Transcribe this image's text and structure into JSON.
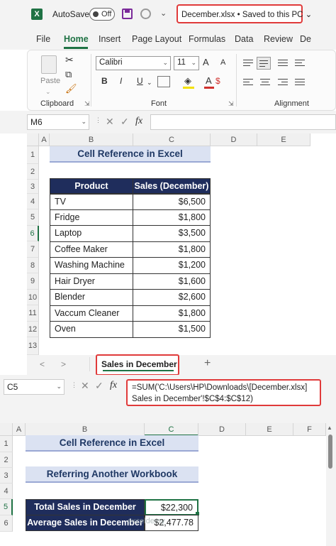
{
  "titlebar": {
    "app_icon": "X",
    "autosave_label": "AutoSave",
    "autosave_state": "Off",
    "filename": "December.xlsx • Saved to this PC ⌄",
    "qat_more": "⌄"
  },
  "ribbon_tabs": [
    "File",
    "Home",
    "Insert",
    "Page Layout",
    "Formulas",
    "Data",
    "Review",
    "De"
  ],
  "ribbon": {
    "paste_label": "Paste",
    "clipboard_label": "Clipboard",
    "font_name": "Calibri",
    "font_size": "11",
    "font_label": "Font",
    "alignment_label": "Alignment",
    "bold": "B",
    "italic": "I",
    "underline": "U",
    "grow_font": "A",
    "shrink_font": "A",
    "currency": "$"
  },
  "formula_bar_top": {
    "name_box": "M6",
    "fx": "fx",
    "formula": ""
  },
  "sheet_top": {
    "columns": [
      "A",
      "B",
      "C",
      "D",
      "E"
    ],
    "rows": [
      "1",
      "2",
      "3",
      "4",
      "5",
      "6",
      "7",
      "8",
      "9",
      "10",
      "11",
      "12",
      "13"
    ],
    "selected_row": "6",
    "title": "Cell Reference in Excel",
    "headers": [
      "Product",
      "Sales (December)"
    ],
    "table": [
      [
        "TV",
        "$6,500"
      ],
      [
        "Fridge",
        "$1,800"
      ],
      [
        "Laptop",
        "$3,500"
      ],
      [
        "Coffee Maker",
        "$1,800"
      ],
      [
        "Washing Machine",
        "$1,200"
      ],
      [
        "Hair Dryer",
        "$1,600"
      ],
      [
        "Blender",
        "$2,600"
      ],
      [
        "Vaccum Cleaner",
        "$1,800"
      ],
      [
        "Oven",
        "$1,500"
      ]
    ]
  },
  "sheet_tabs": {
    "prev": "<",
    "next": ">",
    "active": "Sales in December",
    "add": "+"
  },
  "formula_bar_bottom": {
    "name_box": "C5",
    "fx": "fx",
    "formula_line1": "=SUM('C:\\Users\\HP\\Downloads\\[December.xlsx]",
    "formula_line2": "Sales in December'!$C$4:$C$12)"
  },
  "sheet_bottom": {
    "columns": [
      "A",
      "B",
      "C",
      "D",
      "E",
      "F"
    ],
    "rows": [
      "1",
      "2",
      "3",
      "4",
      "5",
      "6"
    ],
    "title1": "Cell Reference in Excel",
    "title2": "Referring  Another Workbook",
    "total_label": "Total Sales in December",
    "total_value": "$22,300",
    "avg_label": "Average Sales in December",
    "avg_value": "$2,477.78"
  },
  "watermark": "exceldemy"
}
